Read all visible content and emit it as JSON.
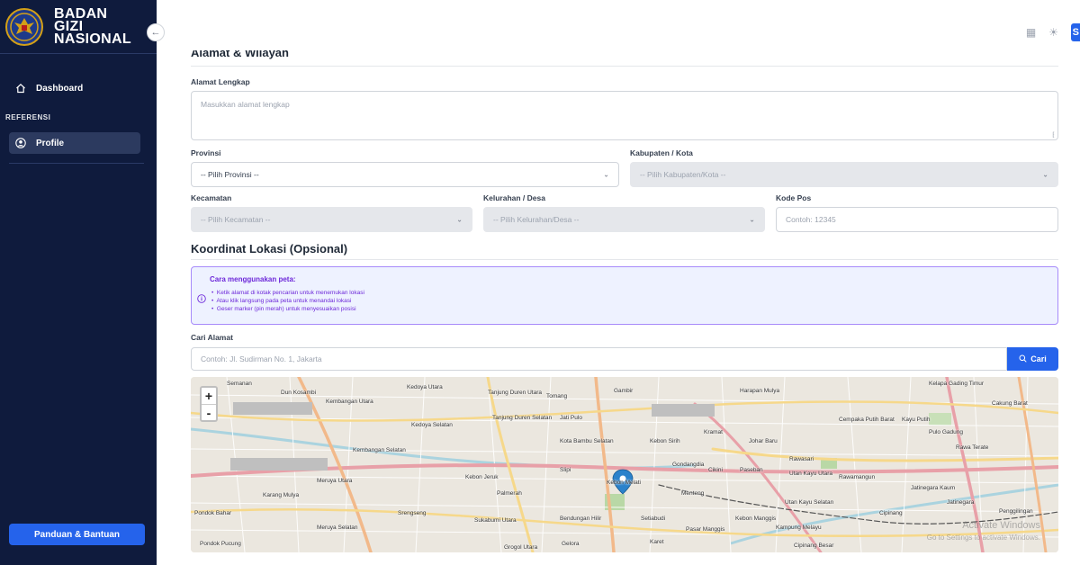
{
  "brand": {
    "line1": "BADAN",
    "line2": "GIZI",
    "line3": "NASIONAL"
  },
  "sidebar": {
    "dashboard_label": "Dashboard",
    "section_label": "REFERENSI",
    "profile_label": "Profile",
    "help_label": "Panduan & Bantuan"
  },
  "topbar": {
    "avatar_letter": "S"
  },
  "address": {
    "section_title": "Alamat & Wilayah",
    "full_address_label": "Alamat Lengkap",
    "full_address_placeholder": "Masukkan alamat lengkap",
    "province_label": "Provinsi",
    "province_value": "-- Pilih Provinsi --",
    "city_label": "Kabupaten / Kota",
    "city_value": "-- Pilih Kabupaten/Kota --",
    "district_label": "Kecamatan",
    "district_value": "-- Pilih Kecamatan --",
    "village_label": "Kelurahan / Desa",
    "village_value": "-- Pilih Kelurahan/Desa --",
    "postal_label": "Kode Pos",
    "postal_placeholder": "Contoh: 12345"
  },
  "coordinates": {
    "section_title": "Koordinat Lokasi (Opsional)",
    "info_title": "Cara menggunakan peta:",
    "info_items": [
      "Ketik alamat di kotak pencarian untuk menemukan lokasi",
      "Atau klik langsung pada peta untuk menandai lokasi",
      "Geser marker (pin merah) untuk menyesuaikan posisi"
    ],
    "search_label": "Cari Alamat",
    "search_placeholder": "Contoh: Jl. Sudirman No. 1, Jakarta",
    "search_button": "Cari"
  },
  "map": {
    "zoom_in": "+",
    "zoom_out": "-",
    "labels": [
      "Semanan",
      "Dun Kosambi",
      "Kembangan Utara",
      "Kedoya Utara",
      "Tanjung Duren Utara",
      "Tomang",
      "Gambir",
      "Harapan Mulya",
      "Kelapa Gading Timur",
      "Cakung Barat",
      "Kedoya Selatan",
      "Tanjung Duren Selatan",
      "Jati Pulo",
      "Kota Bambu Selatan",
      "Kebon Sirih",
      "Kramat",
      "Johar Baru",
      "Cempaka Putih Barat",
      "Kayu Putih",
      "Pulo Gadung",
      "Rawa Terate",
      "Kembangan Selatan",
      "Kebon Jeruk",
      "Slipi",
      "Gondangdia",
      "Cikini",
      "Paseban",
      "Rawasari",
      "Utan Kayu Utara",
      "Rawamangun",
      "Meruya Utara",
      "Karang Mulya",
      "Palmerah",
      "Kebon Melati",
      "Menteng",
      "Utan Kayu Selatan",
      "Jatinegara Kaum",
      "Jatinegara",
      "Cipinang",
      "Penggilingan",
      "Pondok Bahar",
      "Srengseng",
      "Sukabumi Utara",
      "Bendungan Hilir",
      "Setiabudi",
      "Pasar Manggis",
      "Kebon Manggis",
      "Kampung Melayu",
      "Meruya Selatan",
      "Pondok Pucung",
      "Grogol Utara",
      "Gelora",
      "Karet",
      "Cipinang Besar"
    ],
    "watermark_1": "Activate Windows",
    "watermark_2": "Go to Settings to activate Windows."
  },
  "colors": {
    "sidebar_bg": "#0f1b3d",
    "accent": "#2563eb",
    "info_border": "#a78bfa",
    "info_text": "#6d28d9",
    "marker": "#2b82cb"
  }
}
